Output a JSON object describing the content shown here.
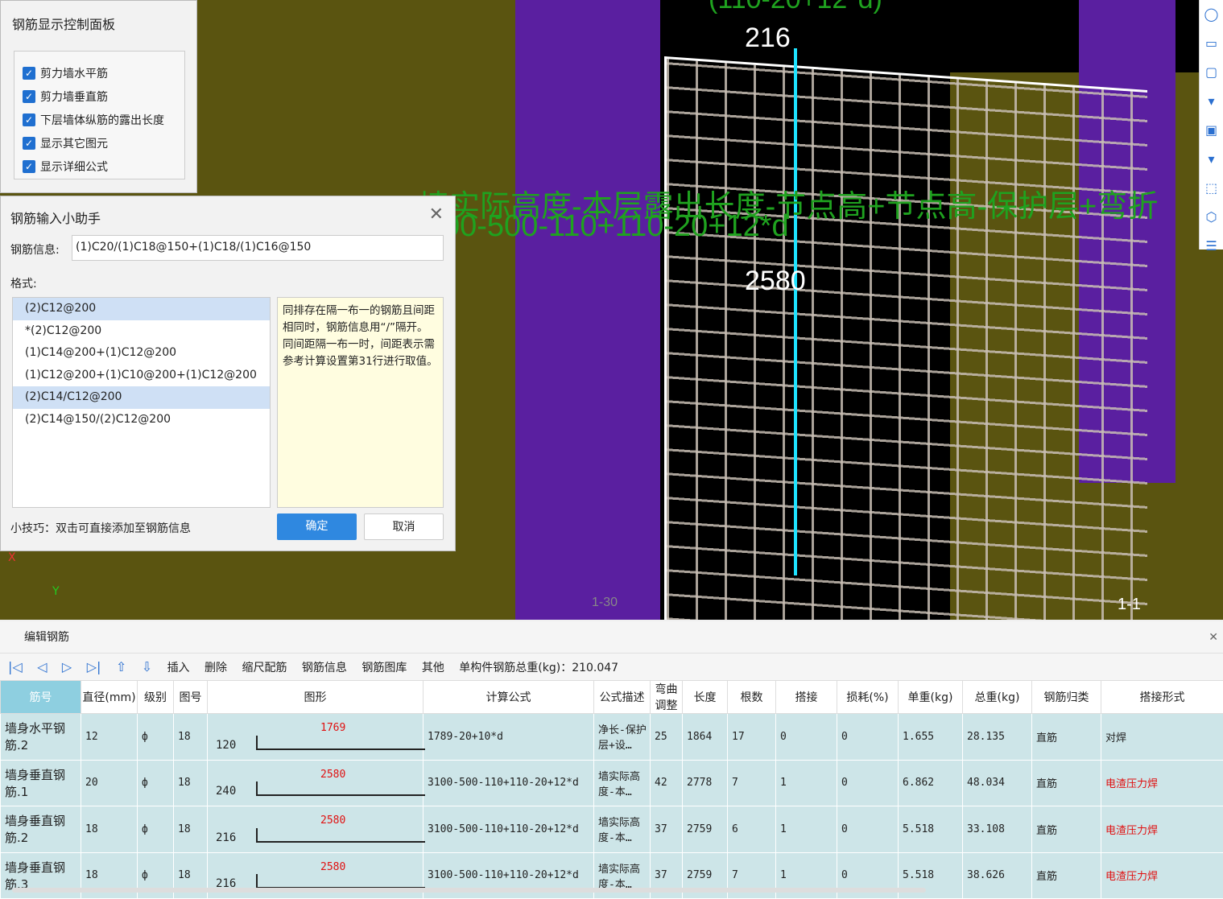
{
  "viewport": {
    "top_label": "(110-20+12*d)",
    "label_216": "216",
    "label_2580": "2580",
    "formula_line1": "墙实际高度-本层露出长度-节点高+节点高-保护层+弯折",
    "formula_line2": "00-500-110+110-20+12*d",
    "corner_label": "1-1",
    "bottom_label": "1-30",
    "axis_x": "X",
    "axis_y": "Y",
    "side_icons": [
      "orbit-icon",
      "2d-icon",
      "cube-icon",
      "caret-icon",
      "cube-solid-icon",
      "caret-icon",
      "select-box-icon",
      "view-cube-icon",
      "layers-icon"
    ]
  },
  "panel": {
    "title": "钢筋显示控制面板",
    "options": [
      "剪力墙水平筋",
      "剪力墙垂直筋",
      "下层墙体纵筋的露出长度",
      "显示其它图元",
      "显示详细公式"
    ]
  },
  "dialog": {
    "title": "钢筋输入小助手",
    "info_label": "钢筋信息:",
    "info_value": "(1)C20/(1)C18@150+(1)C18/(1)C16@150",
    "format_label": "格式:",
    "formats": [
      "(2)C12@200",
      "*(2)C12@200",
      "(1)C14@200+(1)C12@200",
      "(1)C12@200+(1)C10@200+(1)C12@200",
      "(2)C14/C12@200",
      "(2)C14@150/(2)C12@200"
    ],
    "hint": "同排存在隔一布一的钢筋且间距相同时，钢筋信息用“/”隔开。同间距隔一布一时，间距表示需参考计算设置第31行进行取值。",
    "tip": "小技巧：双击可直接添加至钢筋信息",
    "ok": "确定",
    "cancel": "取消"
  },
  "editor": {
    "title": "编辑钢筋",
    "tools": {
      "insert": "插入",
      "delete": "删除",
      "scale": "缩尺配筋",
      "info": "钢筋信息",
      "library": "钢筋图库",
      "other": "其他",
      "total": "单构件钢筋总重(kg)：210.047"
    },
    "headers": [
      "筋号",
      "直径(mm)",
      "级别",
      "图号",
      "图形",
      "计算公式",
      "公式描述",
      "弯曲调整",
      "长度",
      "根数",
      "搭接",
      "损耗(%)",
      "单重(kg)",
      "总重(kg)",
      "钢筋归类",
      "搭接形式"
    ],
    "rows": [
      {
        "idx": "2",
        "name": "墙身水平钢筋.2",
        "dia": "12",
        "grade": "ф",
        "fig": "18",
        "left": "120",
        "mid": "1769",
        "formula": "1789-20+10*d",
        "desc": "净长-保护层+设…",
        "bend": "25",
        "len": "1864",
        "count": "17",
        "lap": "0",
        "loss": "0",
        "unit": "1.655",
        "total": "28.135",
        "cat": "直筋",
        "join": "对焊"
      },
      {
        "idx": "3",
        "name": "墙身垂直钢筋.1",
        "dia": "20",
        "grade": "ф",
        "fig": "18",
        "left": "240",
        "mid": "2580",
        "formula": "3100-500-110+110-20+12*d",
        "desc": "墙实际高度-本…",
        "bend": "42",
        "len": "2778",
        "count": "7",
        "lap": "1",
        "loss": "0",
        "unit": "6.862",
        "total": "48.034",
        "cat": "直筋",
        "join": "电渣压力焊"
      },
      {
        "idx": "4",
        "name": "墙身垂直钢筋.2",
        "dia": "18",
        "grade": "ф",
        "fig": "18",
        "left": "216",
        "mid": "2580",
        "formula": "3100-500-110+110-20+12*d",
        "desc": "墙实际高度-本…",
        "bend": "37",
        "len": "2759",
        "count": "6",
        "lap": "1",
        "loss": "0",
        "unit": "5.518",
        "total": "33.108",
        "cat": "直筋",
        "join": "电渣压力焊"
      },
      {
        "idx": "5",
        "name": "墙身垂直钢筋.3",
        "dia": "18",
        "grade": "ф",
        "fig": "18",
        "left": "216",
        "mid": "2580",
        "formula": "3100-500-110+110-20+12*d",
        "desc": "墙实际高度-本…",
        "bend": "37",
        "len": "2759",
        "count": "7",
        "lap": "1",
        "loss": "0",
        "unit": "5.518",
        "total": "38.626",
        "cat": "直筋",
        "join": "电渣压力焊"
      }
    ]
  }
}
